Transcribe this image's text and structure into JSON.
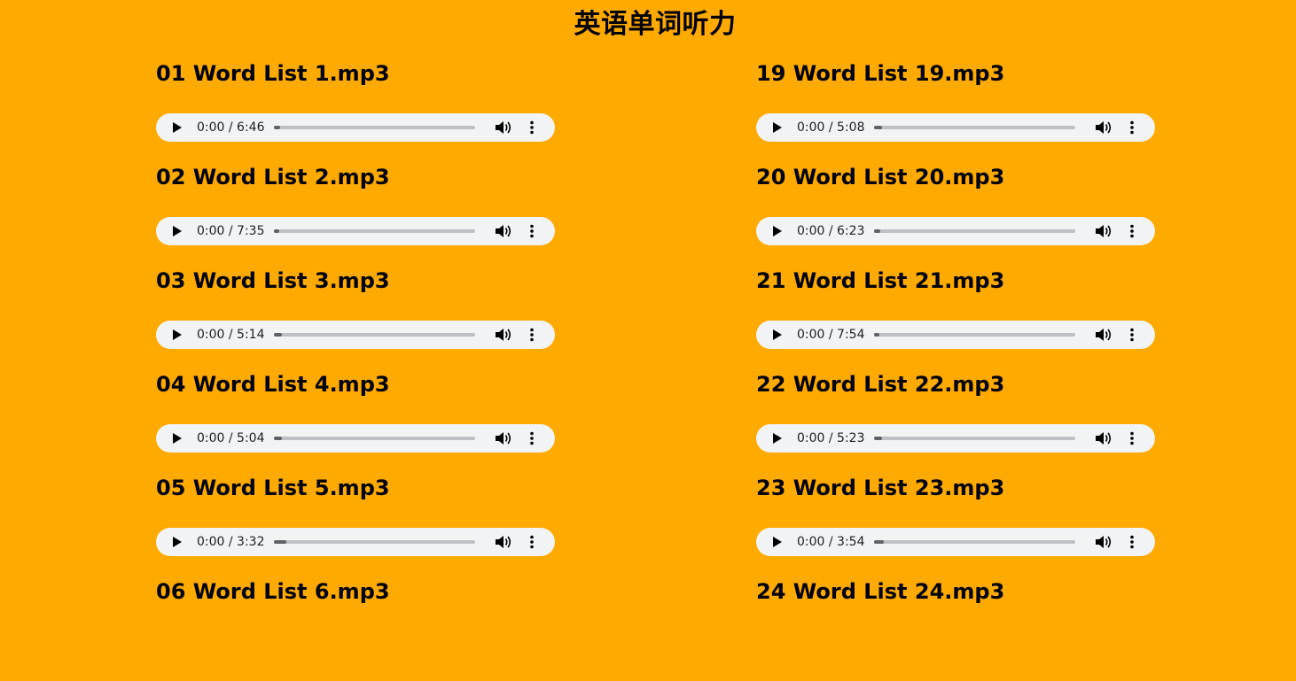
{
  "header": {
    "title": "英语单词听力"
  },
  "columns": [
    {
      "tracks": [
        {
          "title": "01 Word List 1.mp3",
          "time": "0:00 / 6:46",
          "progress": 0.03
        },
        {
          "title": "02 Word List 2.mp3",
          "time": "0:00 / 7:35",
          "progress": 0.02
        },
        {
          "title": "03 Word List 3.mp3",
          "time": "0:00 / 5:14",
          "progress": 0.04
        },
        {
          "title": "04 Word List 4.mp3",
          "time": "0:00 / 5:04",
          "progress": 0.04
        },
        {
          "title": "05 Word List 5.mp3",
          "time": "0:00 / 3:32",
          "progress": 0.06
        },
        {
          "title": "06 Word List 6.mp3",
          "time": "",
          "progress": 0
        }
      ]
    },
    {
      "tracks": [
        {
          "title": "19 Word List 19.mp3",
          "time": "0:00 / 5:08",
          "progress": 0.04
        },
        {
          "title": "20 Word List 20.mp3",
          "time": "0:00 / 6:23",
          "progress": 0.03
        },
        {
          "title": "21 Word List 21.mp3",
          "time": "0:00 / 7:54",
          "progress": 0.02
        },
        {
          "title": "22 Word List 22.mp3",
          "time": "0:00 / 5:23",
          "progress": 0.04
        },
        {
          "title": "23 Word List 23.mp3",
          "time": "0:00 / 3:54",
          "progress": 0.05
        },
        {
          "title": "24 Word List 24.mp3",
          "time": "",
          "progress": 0
        }
      ]
    }
  ],
  "colors": {
    "background": "#FFAA00",
    "player_bg": "#F1F3F4",
    "seek_track": "#BDC1C6",
    "seek_fill": "#5F6368"
  },
  "icons": {
    "play": "play-icon",
    "volume": "volume-icon",
    "more": "more-options-icon"
  }
}
